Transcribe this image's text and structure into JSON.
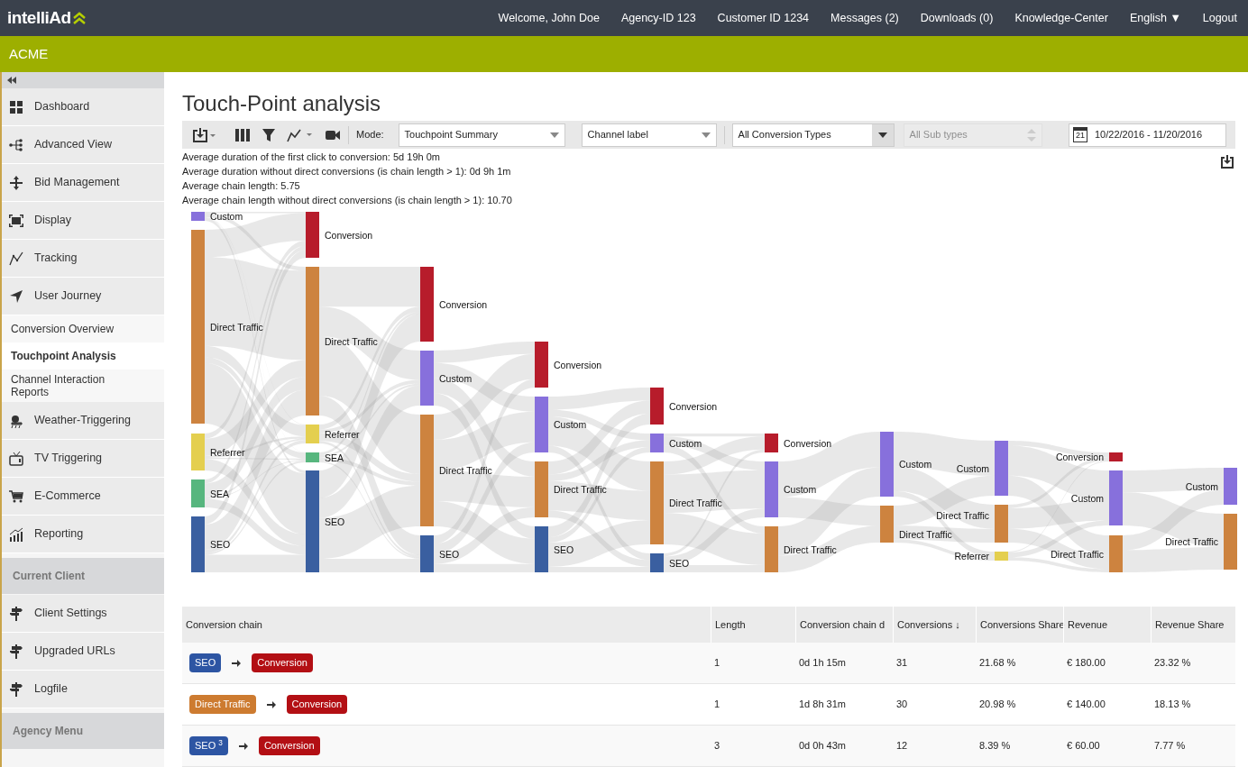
{
  "header": {
    "logo": "intelliAd",
    "nav": [
      "Welcome, John Doe",
      "Agency-ID 123",
      "Customer ID 1234",
      "Messages (2)",
      "Downloads (0)",
      "Knowledge-Center",
      "English ▼",
      "Logout"
    ]
  },
  "client_bar": {
    "title": "ACME"
  },
  "sidebar": {
    "items": [
      {
        "kind": "item",
        "label": "Dashboard",
        "selected": false
      },
      {
        "kind": "item",
        "label": "Advanced View",
        "selected": false
      },
      {
        "kind": "item",
        "label": "Bid Management",
        "selected": false
      },
      {
        "kind": "item",
        "label": "Display",
        "selected": false
      },
      {
        "kind": "item",
        "label": "Tracking",
        "selected": false
      },
      {
        "kind": "item",
        "label": "User Journey",
        "selected": false
      },
      {
        "kind": "subitem",
        "label": "Conversion Overview",
        "selected": false
      },
      {
        "kind": "subitem",
        "label": "Touchpoint Analysis",
        "selected": true
      },
      {
        "kind": "subitem",
        "label": "Channel Interaction Reports",
        "selected": false
      },
      {
        "kind": "item",
        "label": "Weather-Triggering",
        "selected": false
      },
      {
        "kind": "item",
        "label": "TV Triggering",
        "selected": false
      },
      {
        "kind": "item",
        "label": "E-Commerce",
        "selected": false
      },
      {
        "kind": "item",
        "label": "Reporting",
        "selected": false
      },
      {
        "kind": "section",
        "label": "Current Client",
        "selected": false
      },
      {
        "kind": "item",
        "label": "Client Settings",
        "selected": false
      },
      {
        "kind": "item",
        "label": "Upgraded URLs",
        "selected": false
      },
      {
        "kind": "item",
        "label": "Logfile",
        "selected": false
      },
      {
        "kind": "section",
        "label": "Agency Menu",
        "selected": false
      }
    ]
  },
  "page": {
    "title": "Touch-Point analysis"
  },
  "toolbar": {
    "mode_label": "Mode:",
    "mode": "Touchpoint Summary",
    "label_select": "Channel label",
    "conversion_types": "All Conversion Types",
    "sub_types": {
      "placeholder": "All Sub types",
      "disabled": true
    },
    "calendar_day": "21",
    "date_range": "10/22/2016 - 11/20/2016"
  },
  "stats": [
    "Average duration of the first click to conversion: 5d 19h 0m",
    "Average duration without direct conversions (is chain length > 1): 0d 9h 1m",
    "Average chain length: 5.75",
    "Average chain length without direct conversions (is chain length > 1): 10.70"
  ],
  "sankey": {
    "columns": [
      [
        {
          "label": "Custom",
          "color": "#8770dc"
        },
        {
          "label": "Direct Traffic",
          "color": "#cd833f"
        },
        {
          "label": "Referrer",
          "color": "#e4cf4f"
        },
        {
          "label": "SEA",
          "color": "#57b67e"
        },
        {
          "label": "SEO",
          "color": "#3a5fa0"
        }
      ],
      [
        {
          "label": "Conversion",
          "color": "#b71c2b"
        },
        {
          "label": "Direct Traffic",
          "color": "#cd833f"
        },
        {
          "label": "Referrer",
          "color": "#e4cf4f"
        },
        {
          "label": "SEA",
          "color": "#57b67e"
        },
        {
          "label": "SEO",
          "color": "#3a5fa0"
        }
      ],
      [
        {
          "label": "Conversion",
          "color": "#b71c2b"
        },
        {
          "label": "Custom",
          "color": "#8770dc"
        },
        {
          "label": "Direct Traffic",
          "color": "#cd833f"
        },
        {
          "label": "SEO",
          "color": "#3a5fa0"
        }
      ],
      [
        {
          "label": "Conversion",
          "color": "#b71c2b"
        },
        {
          "label": "Custom",
          "color": "#8770dc"
        },
        {
          "label": "Direct Traffic",
          "color": "#cd833f"
        },
        {
          "label": "SEO",
          "color": "#3a5fa0"
        }
      ],
      [
        {
          "label": "Conversion",
          "color": "#b71c2b"
        },
        {
          "label": "Custom",
          "color": "#8770dc"
        },
        {
          "label": "Direct Traffic",
          "color": "#cd833f"
        },
        {
          "label": "SEO",
          "color": "#3a5fa0"
        }
      ],
      [
        {
          "label": "Conversion",
          "color": "#b71c2b"
        },
        {
          "label": "Custom",
          "color": "#8770dc"
        },
        {
          "label": "Direct Traffic",
          "color": "#cd833f"
        }
      ],
      [
        {
          "label": "Custom",
          "color": "#8770dc"
        },
        {
          "label": "Direct Traffic",
          "color": "#cd833f"
        }
      ],
      [
        {
          "label": "Custom",
          "color": "#8770dc"
        },
        {
          "label": "Direct Traffic",
          "color": "#cd833f"
        },
        {
          "label": "Referrer",
          "color": "#e4cf4f"
        }
      ],
      [
        {
          "label": "Conversion",
          "color": "#b71c2b"
        },
        {
          "label": "Custom",
          "color": "#8770dc"
        },
        {
          "label": "Direct Traffic",
          "color": "#cd833f"
        }
      ],
      [
        {
          "label": "Custom",
          "color": "#8770dc"
        },
        {
          "label": "Direct Traffic",
          "color": "#cd833f"
        }
      ]
    ]
  },
  "table": {
    "columns": [
      "Conversion chain",
      "Length",
      "Conversion chain d",
      "Conversions ↓",
      "Conversions Share",
      "Revenue",
      "Revenue Share"
    ],
    "rows": [
      {
        "cells": [
          {
            "chain": [
              {
                "label": "SEO",
                "color": "#2d55a3"
              },
              {
                "label": "Conversion",
                "color": "#b30f14"
              }
            ]
          },
          "1",
          "0d 1h 15m",
          "31",
          "21.68 %",
          "€ 180.00",
          "23.32 %"
        ]
      },
      {
        "cells": [
          {
            "chain": [
              {
                "label": "Direct Traffic",
                "color": "#cd7b30"
              },
              {
                "label": "Conversion",
                "color": "#b30f14"
              }
            ]
          },
          "1",
          "1d 8h 31m",
          "30",
          "20.98 %",
          "€ 140.00",
          "18.13 %"
        ]
      },
      {
        "cells": [
          {
            "chain": [
              {
                "label": "SEO $^{3}$",
                "color": "#2d55a3"
              },
              {
                "label": "Conversion",
                "color": "#b30f14"
              }
            ]
          },
          "3",
          "0d 0h 43m",
          "12",
          "8.39 %",
          "€ 60.00",
          "7.77 %"
        ]
      }
    ]
  }
}
